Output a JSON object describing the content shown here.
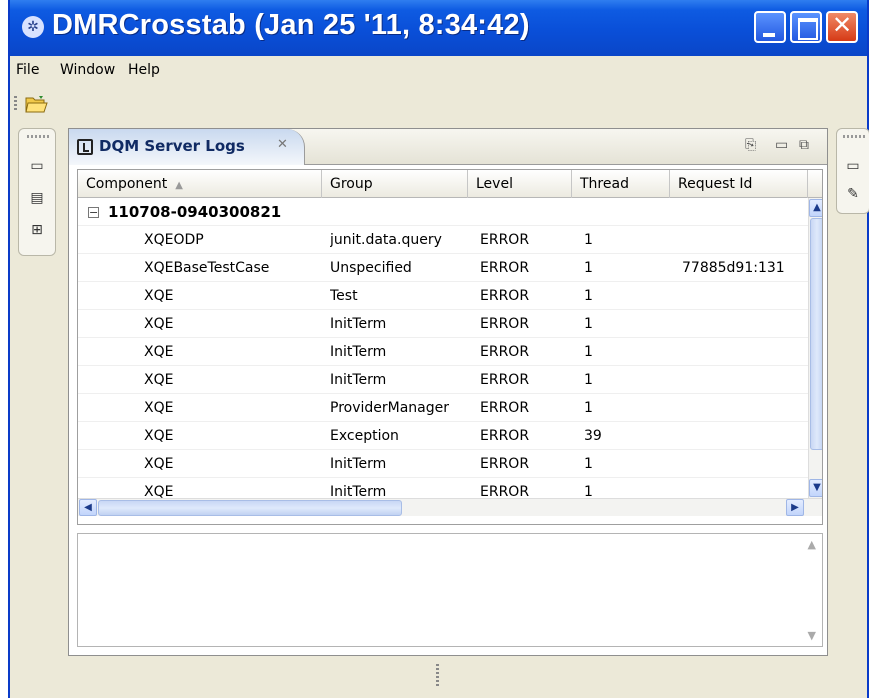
{
  "window": {
    "title": "DMRCrosstab (Jan 25 '11, 8:34:42)",
    "close_glyph": "✕"
  },
  "menu": [
    {
      "label": "File"
    },
    {
      "label": "Window"
    },
    {
      "label": "Help"
    }
  ],
  "icons": {
    "open": "folder-open-icon"
  },
  "view": {
    "tab_label": "DQM Server Logs",
    "tab_close": "✕",
    "tool_export": "⎘",
    "tool_minimize": "▭",
    "tool_maximize": "⧉"
  },
  "table": {
    "columns": [
      "Component",
      "Group",
      "Level",
      "Thread",
      "Request Id"
    ],
    "sort_indicator": "▲",
    "group_toggle": "−",
    "group_label": "110708-0940300821",
    "rows": [
      [
        "XQEODP",
        "junit.data.query",
        "ERROR",
        "1",
        ""
      ],
      [
        "XQEBaseTestCase",
        "Unspecified",
        "ERROR",
        "1",
        "77885d91:131"
      ],
      [
        "XQE",
        "Test",
        "ERROR",
        "1",
        ""
      ],
      [
        "XQE",
        "InitTerm",
        "ERROR",
        "1",
        ""
      ],
      [
        "XQE",
        "InitTerm",
        "ERROR",
        "1",
        ""
      ],
      [
        "XQE",
        "InitTerm",
        "ERROR",
        "1",
        ""
      ],
      [
        "XQE",
        "ProviderManager",
        "ERROR",
        "1",
        ""
      ],
      [
        "XQE",
        "Exception",
        "ERROR",
        "39",
        ""
      ],
      [
        "XQE",
        "InitTerm",
        "ERROR",
        "1",
        ""
      ],
      [
        "XQE",
        "InitTerm",
        "ERROR",
        "1",
        ""
      ]
    ]
  },
  "scroll": {
    "up": "▲",
    "down": "▼",
    "left": "◀",
    "right": "▶"
  }
}
